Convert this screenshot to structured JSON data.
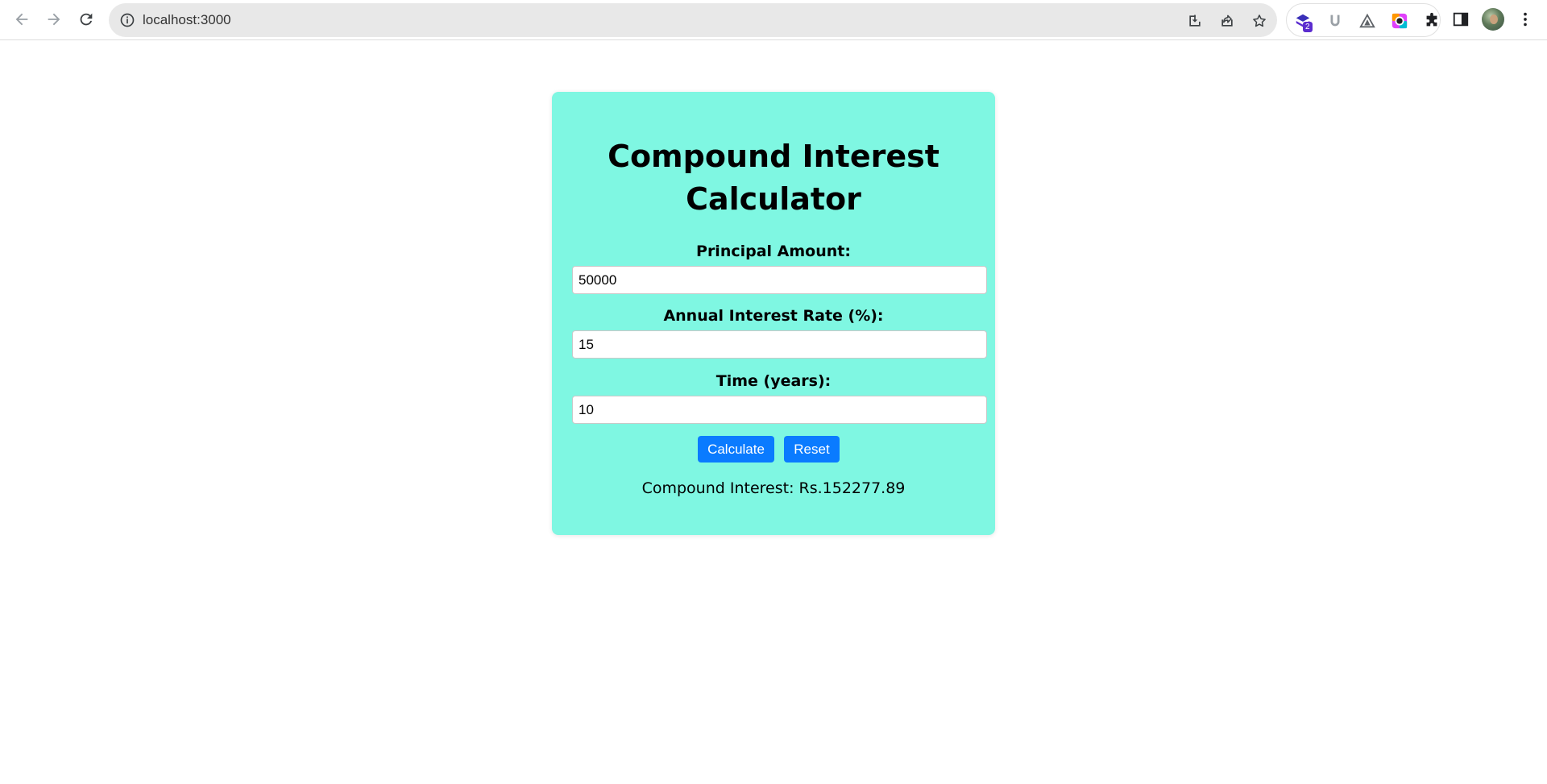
{
  "browser": {
    "url": "localhost:3000",
    "extensions": [
      {
        "name": "layers-extension-icon",
        "badge": "2"
      },
      {
        "name": "u-extension-icon"
      },
      {
        "name": "triangle-extension-icon"
      },
      {
        "name": "color-ring-extension-icon"
      },
      {
        "name": "puzzle-icon"
      }
    ]
  },
  "app": {
    "title": "Compound Interest Calculator",
    "fields": [
      {
        "label": "Principal Amount:",
        "value": "50000"
      },
      {
        "label": "Annual Interest Rate (%):",
        "value": "15"
      },
      {
        "label": "Time (years):",
        "value": "10"
      }
    ],
    "buttons": {
      "calculate": "Calculate",
      "reset": "Reset"
    },
    "result": "Compound Interest: Rs.152277.89"
  },
  "colors": {
    "card_background": "#7ff7e2",
    "button_background": "#0a7bff",
    "page_background": "#ffffff"
  }
}
